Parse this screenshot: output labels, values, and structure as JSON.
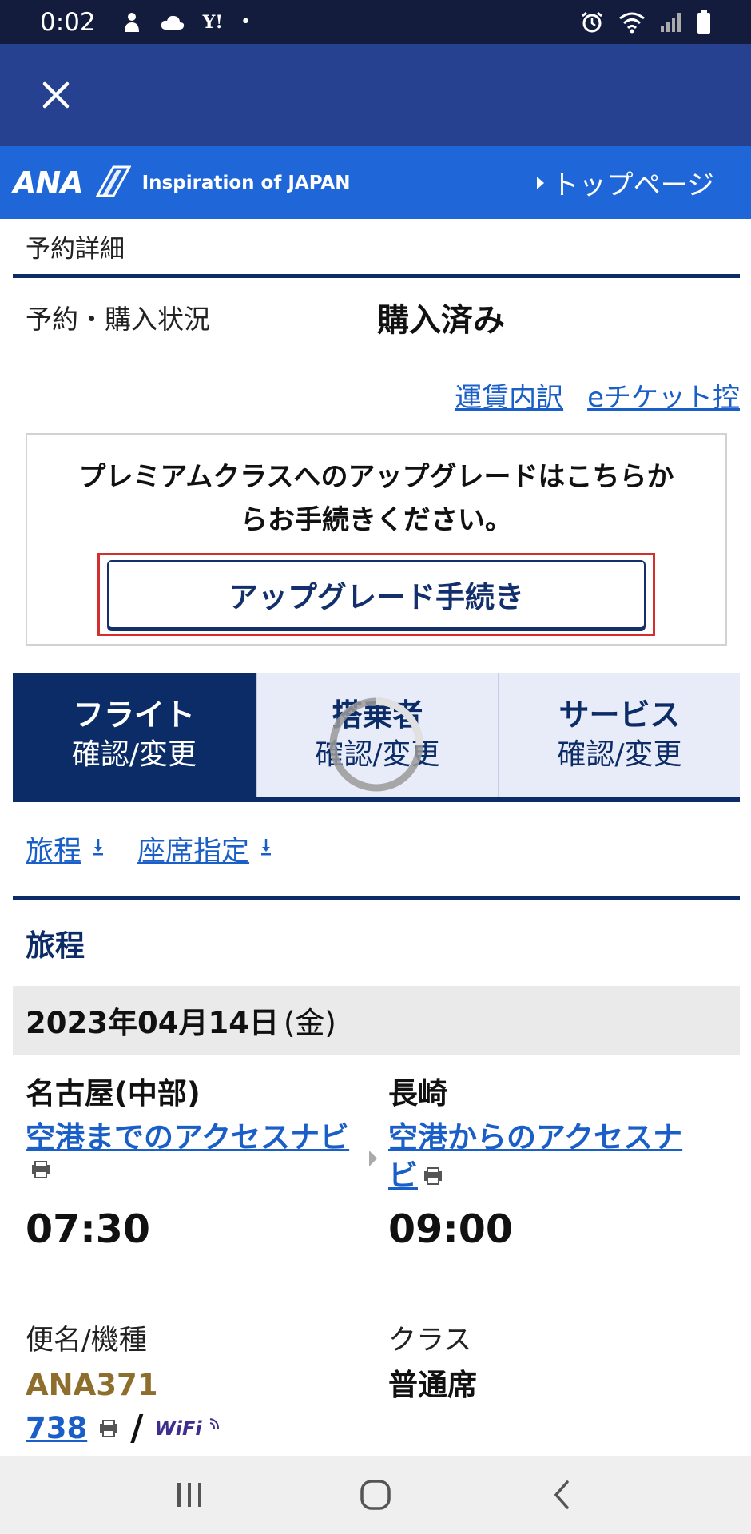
{
  "status_bar": {
    "time": "0:02",
    "yahoo": "Y!",
    "dot": "•"
  },
  "header": {
    "close_icon": "close-icon"
  },
  "ana_band": {
    "logo_text": "ANA",
    "tagline": "Inspiration of JAPAN",
    "top_page_link": "トップページ"
  },
  "reservation": {
    "section_title": "予約詳細",
    "status_label": "予約・購入状況",
    "status_value": "購入済み",
    "links": [
      "運賃内訳",
      "eチケット控"
    ]
  },
  "upgrade": {
    "text_line1": "プレミアムクラスへのアップグレードはこちらか",
    "text_line2": "らお手続きください。",
    "button_label": "アップグレード手続き",
    "highlight_color": "#d32f2f"
  },
  "tabs": [
    {
      "title": "フライト",
      "sub": "確認/変更",
      "active": true
    },
    {
      "title": "搭乗者",
      "sub": "確認/変更",
      "active": false
    },
    {
      "title": "サービス",
      "sub": "確認/変更",
      "active": false
    }
  ],
  "anchors": [
    "旅程",
    "座席指定"
  ],
  "itinerary": {
    "title": "旅程",
    "date": "2023年04月14日",
    "day_of_week": "(金)",
    "departure": {
      "airport": "名古屋(中部)",
      "access_link": "空港までのアクセスナビ",
      "time": "07:30"
    },
    "arrival": {
      "airport": "長崎",
      "access_link_line1": "空港からのアクセスナ",
      "access_link_line2": "ビ",
      "time": "09:00"
    },
    "flight_label": "便名/機種",
    "flight_no": "ANA371",
    "aircraft": "738",
    "slash": "/",
    "wifi": "WiFi",
    "class_label": "クラス",
    "class_value": "普通席"
  },
  "colors": {
    "status_bar": "#141c3e",
    "header": "#25418f",
    "ana_blue": "#1f66d8",
    "navy": "#0b2c66",
    "link": "#1a5ec8"
  }
}
